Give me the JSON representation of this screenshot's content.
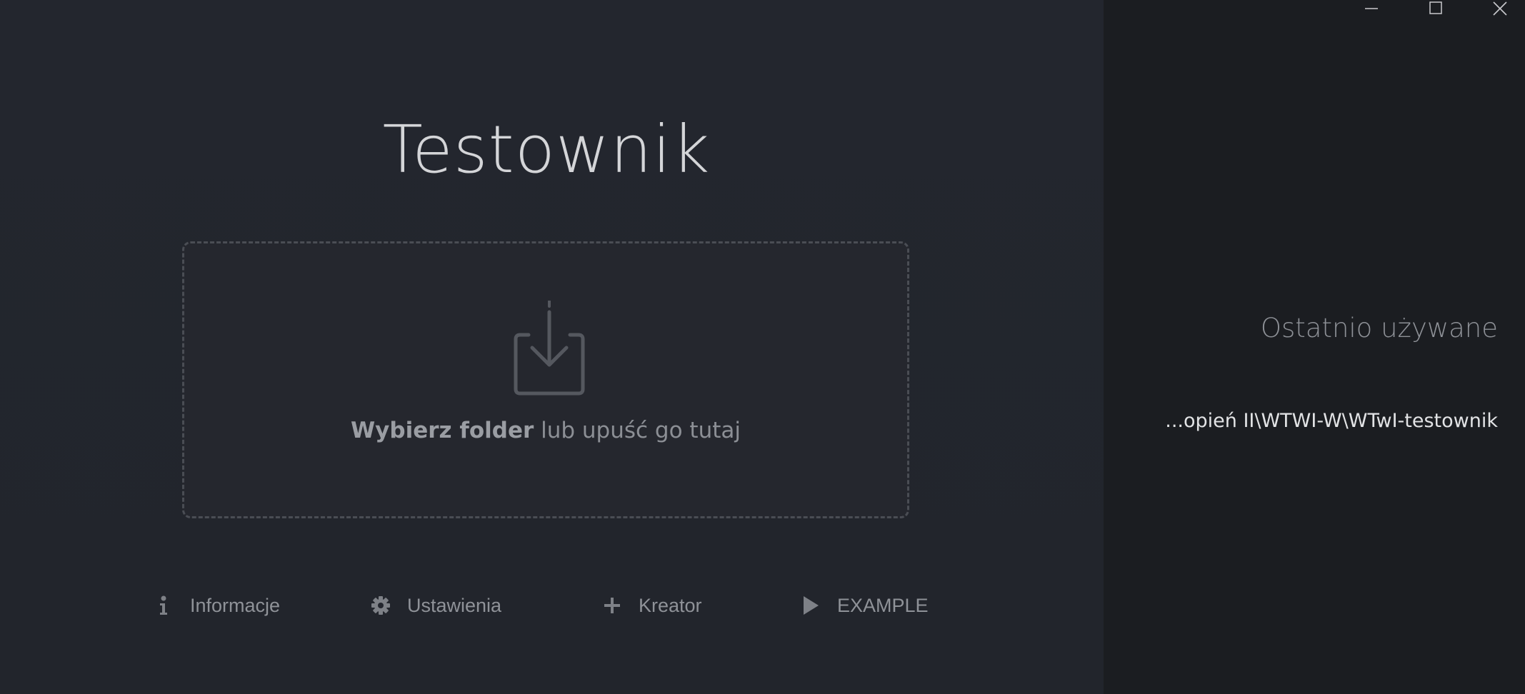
{
  "app": {
    "title": "Testownik"
  },
  "dropzone": {
    "action_label": "Wybierz folder",
    "hint_label": " lub upuść go tutaj",
    "icon": "download-tray-icon"
  },
  "actions": [
    {
      "label": "Informacje",
      "icon": "info-icon"
    },
    {
      "label": "Ustawienia",
      "icon": "gear-icon"
    },
    {
      "label": "Kreator",
      "icon": "plus-icon"
    },
    {
      "label": "EXAMPLE",
      "icon": "play-icon"
    }
  ],
  "recent": {
    "title": "Ostatnio używane",
    "items": [
      {
        "path": "...opień II\\WTWI-W\\WTwI-testownik"
      }
    ]
  },
  "window_controls": [
    "minimize-icon",
    "maximize-icon",
    "close-icon"
  ],
  "colors": {
    "main_bg": "#22252d",
    "side_bg": "#1b1d21",
    "muted_text": "#8f9298",
    "title_text": "#d4d5d8"
  }
}
